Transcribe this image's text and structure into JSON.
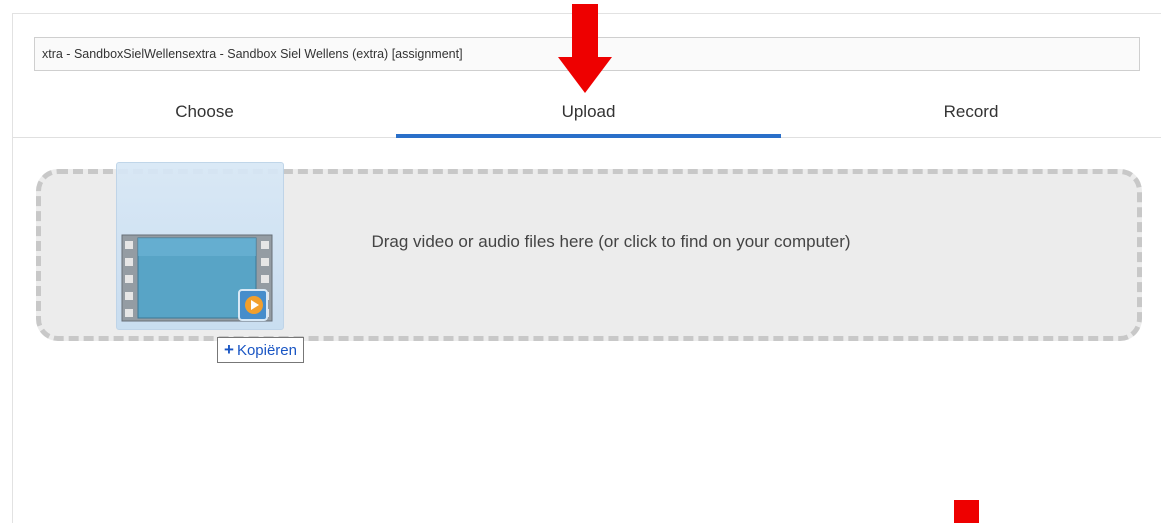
{
  "title_field": {
    "value": "xtra - SandboxSielWellensextra - Sandbox Siel Wellens (extra) [assignment]"
  },
  "tabs": [
    {
      "label": "Choose"
    },
    {
      "label": "Upload"
    },
    {
      "label": "Record"
    }
  ],
  "active_tab": "Upload",
  "dropzone": {
    "text": "Drag video or audio files here (or click to find on your computer)"
  },
  "drag_ghost": {
    "icon": "video-file-icon",
    "tooltip": "Kopiëren",
    "tooltip_icon": "plus-icon"
  },
  "annotations": {
    "arrow_color": "#ee0000",
    "marker_color": "#ee0000"
  },
  "colors": {
    "accent": "#2a6fc9",
    "tooltip_text": "#1a56c4"
  }
}
